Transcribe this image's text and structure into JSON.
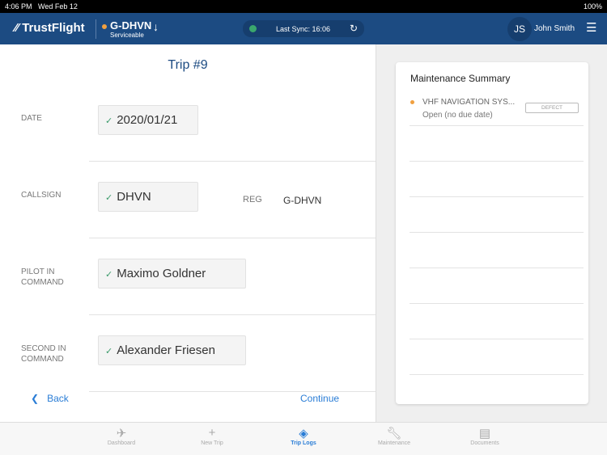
{
  "status_bar": {
    "time": "4:06 PM",
    "date": "Wed Feb 12",
    "battery": "100%"
  },
  "header": {
    "brand": "TrustFlight",
    "aircraft": "G-DHVN",
    "aircraft_status": "Serviceable",
    "sync": "Last Sync: 16:06",
    "user_initials": "JS",
    "user_name": "John Smith"
  },
  "form": {
    "title": "Trip #9",
    "date_label": "DATE",
    "date_value": "2020/01/21",
    "callsign_label": "CALLSIGN",
    "callsign_value": "DHVN",
    "reg_label": "REG",
    "reg_value": "G-DHVN",
    "pic_label": "PILOT IN COMMAND",
    "pic_value": "Maximo Goldner",
    "sic_label": "SECOND IN COMMAND",
    "sic_value": "Alexander Friesen",
    "back": "Back",
    "continue": "Continue"
  },
  "maintenance": {
    "title": "Maintenance Summary",
    "items": [
      {
        "name": "VHF NAVIGATION SYS...",
        "status": "Open (no due date)",
        "badge": "DEFECT"
      }
    ]
  },
  "tabs": [
    "Dashboard",
    "New Trip",
    "Trip Logs",
    "Maintenance",
    "Documents"
  ],
  "colors": {
    "nav": "#1c4b82",
    "accent": "#2a7dd6",
    "warning": "#f0a040",
    "ok": "#3aa76d"
  }
}
